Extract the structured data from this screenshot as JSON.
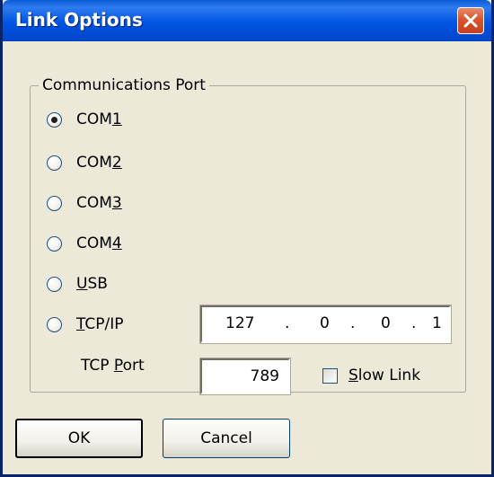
{
  "window": {
    "title": "Link Options",
    "close_icon": "close-icon",
    "close_color": "#d8552d",
    "titlebar_color": "#0054e3"
  },
  "group": {
    "label": "Communications Port"
  },
  "radios": [
    {
      "label_pre": "COM",
      "label_ul": "1",
      "label_post": "",
      "selected": true
    },
    {
      "label_pre": "COM",
      "label_ul": "2",
      "label_post": "",
      "selected": false
    },
    {
      "label_pre": "COM",
      "label_ul": "3",
      "label_post": "",
      "selected": false
    },
    {
      "label_pre": "COM",
      "label_ul": "4",
      "label_post": "",
      "selected": false
    },
    {
      "label_pre": "",
      "label_ul": "U",
      "label_post": "SB",
      "selected": false
    },
    {
      "label_pre": "",
      "label_ul": "T",
      "label_post": "CP/IP",
      "selected": false
    }
  ],
  "ip_address": {
    "octets": [
      "127",
      "0",
      "0",
      "1"
    ],
    "separator": "."
  },
  "tcp_port": {
    "label_pre": "TCP ",
    "label_ul": "P",
    "label_post": "ort",
    "value": "789"
  },
  "slow_link": {
    "label_ul": "S",
    "label_post": "low Link",
    "checked": false
  },
  "buttons": {
    "ok": "OK",
    "cancel": "Cancel"
  }
}
